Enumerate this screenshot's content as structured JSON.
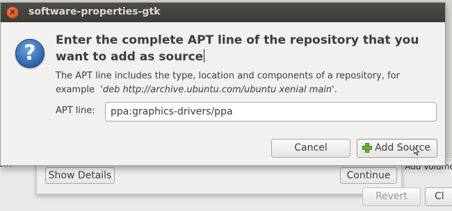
{
  "background": {
    "left_strip_text": "...om",
    "right_strip_text": "Add Volume",
    "show_details_label": "Show Details",
    "continue_label": "Continue",
    "revert_label": "Revert",
    "close_partial_label": "Cl"
  },
  "dialog": {
    "title": "software-properties-gtk",
    "close_icon": "close-icon",
    "question_icon_glyph": "?",
    "heading": "Enter the complete APT line of the repository that you want to add as source",
    "description_text": "The APT line includes the type, location and components of a repository, for example",
    "description_example": "deb http://archive.ubuntu.com/ubuntu xenial main",
    "apt_line_label": "APT line:",
    "apt_line_value": "ppa:graphics-drivers/ppa",
    "cancel_label": "Cancel",
    "add_source_label": "Add Source"
  },
  "colors": {
    "titlebar": "#3c3b37",
    "close_button": "#e05b2a",
    "dialog_bg": "#f2f1f0",
    "question_icon": "#2a63a8",
    "plus_icon": "#6bb33a"
  }
}
